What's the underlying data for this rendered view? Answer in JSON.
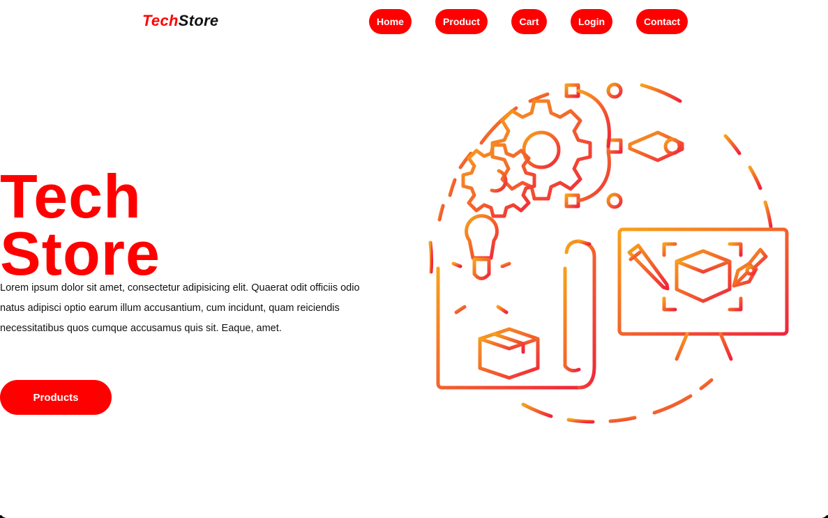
{
  "header": {
    "logo": {
      "accent": "Tech",
      "rest": "Store"
    },
    "nav": [
      {
        "label": "Home"
      },
      {
        "label": "Product"
      },
      {
        "label": "Cart"
      },
      {
        "label": "Login"
      },
      {
        "label": "Contact"
      }
    ]
  },
  "hero": {
    "title_line1": "Tech",
    "title_line2": "Store",
    "paragraph": "Lorem ipsum dolor sit amet, consectetur adipisicing elit. Quaerat odit officiis odio natus adipisci optio earum illum accusantium, cum incidunt, quam reiciendis necessitatibus quos cumque accusamus quis sit. Eaque, amet.",
    "cta_label": "Products"
  },
  "illustration": {
    "icon": "design-development-illustration-icon",
    "gradient_start": "#f7a21b",
    "gradient_end": "#f0243c"
  },
  "colors": {
    "accent": "#ff0000",
    "text": "#111111",
    "background": "#ffffff"
  }
}
